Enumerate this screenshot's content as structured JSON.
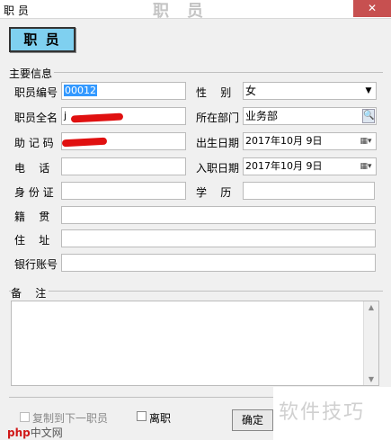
{
  "window": {
    "title": "职 员",
    "title_ghost": "职员",
    "close_glyph": "✕"
  },
  "header_button": "职  员",
  "group_title": "主要信息",
  "fields": {
    "emp_no_label": "职员编号",
    "emp_no_value": "00012",
    "gender_label": "性    别",
    "gender_value": "女",
    "name_label": "职员全名",
    "name_value": "j",
    "dept_label": "所在部门",
    "dept_value": "业务部",
    "mnemonic_label": "助 记 码",
    "birth_label": "出生日期",
    "birth_value": "2017年10月 9日",
    "phone_label": "电    话",
    "join_label": "入职日期",
    "join_value": "2017年10月 9日",
    "id_label": "身 份 证",
    "edu_label": "学    历",
    "origin_label": "籍    贯",
    "address_label": "住    址",
    "bank_label": "银行账号"
  },
  "memo_label": "备    注",
  "bottom": {
    "copy_label": "复制到下一职员",
    "resign_label": "离职",
    "ok_label": "确定"
  },
  "watermark": {
    "text": "软件技巧",
    "logo_left": "php",
    "logo_right": "中文网"
  },
  "icons": {
    "dropdown": "▼",
    "calendar": "▦▾",
    "search": "🔍",
    "scroll_up": "▲",
    "scroll_down": "▼"
  },
  "colors": {
    "header_button": "#7fd0f0",
    "selection": "#3399ff",
    "close": "#c75050",
    "scribble": "#e01010"
  }
}
